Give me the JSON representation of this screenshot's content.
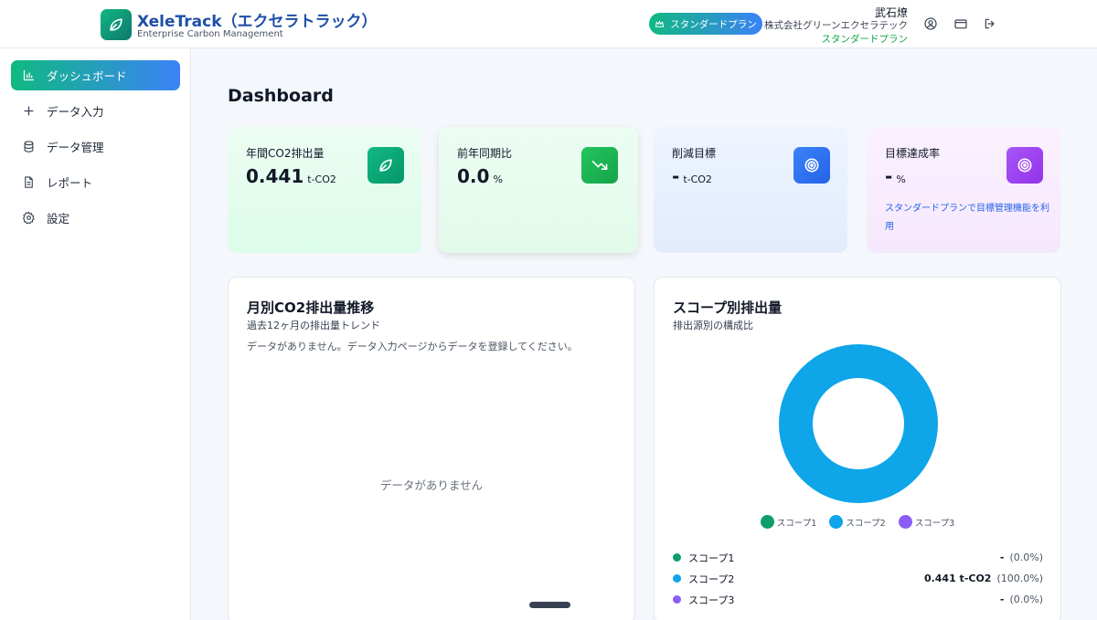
{
  "header": {
    "app_title": "XeleTrack（エクセラトラック）",
    "app_subtitle": "Enterprise Carbon Management",
    "plan_button": "スタンダードプラン",
    "user_name": "武石燎",
    "company": "株式会社グリーンエクセラテック",
    "user_plan": "スタンダードプラン"
  },
  "sidebar": {
    "items": [
      {
        "label": "ダッシュボード",
        "icon": "bar-chart-icon",
        "active": true
      },
      {
        "label": "データ入力",
        "icon": "plus-icon",
        "active": false
      },
      {
        "label": "データ管理",
        "icon": "database-icon",
        "active": false
      },
      {
        "label": "レポート",
        "icon": "document-icon",
        "active": false
      },
      {
        "label": "設定",
        "icon": "gear-icon",
        "active": false
      }
    ]
  },
  "main": {
    "title": "Dashboard",
    "cards": [
      {
        "label": "年間CO2排出量",
        "value": "0.441",
        "unit": "t-CO2",
        "icon": "leaf-icon",
        "color": "#10b981"
      },
      {
        "label": "前年同期比",
        "value": "0.0",
        "unit": "%",
        "icon": "trending-down-icon",
        "color": "#16a34a"
      },
      {
        "label": "削減目標",
        "value": "-",
        "unit": "t-CO2",
        "icon": "target-icon",
        "color": "#2563eb"
      },
      {
        "label": "目標達成率",
        "value": "-",
        "unit": "%",
        "icon": "target-icon",
        "color": "#9333ea",
        "note": "スタンダードプランで目標管理機能を利用"
      }
    ],
    "monthly_panel": {
      "title": "月別CO2排出量推移",
      "subtitle": "過去12ヶ月の排出量トレンド",
      "message": "データがありません。データ入力ページからデータを登録してください。",
      "empty": "データがありません"
    },
    "scope_panel": {
      "title": "スコープ別排出量",
      "subtitle": "排出源別の構成比",
      "legend": [
        "スコープ1",
        "スコープ2",
        "スコープ3"
      ],
      "rows": [
        {
          "name": "スコープ1",
          "value": "-",
          "pct": "(0.0%)",
          "color": "#0f9d6b"
        },
        {
          "name": "スコープ2",
          "value": "0.441 t-CO2",
          "pct": "(100.0%)",
          "color": "#0ea5e9"
        },
        {
          "name": "スコープ3",
          "value": "-",
          "pct": "(0.0%)",
          "color": "#8b5cf6"
        }
      ]
    }
  },
  "chart_data": {
    "type": "pie",
    "categories": [
      "スコープ1",
      "スコープ2",
      "スコープ3"
    ],
    "values": [
      0,
      0.441,
      0
    ],
    "colors": [
      "#0f9d6b",
      "#0ea5e9",
      "#8b5cf6"
    ],
    "title": "スコープ別排出量",
    "legend": "bottom"
  }
}
